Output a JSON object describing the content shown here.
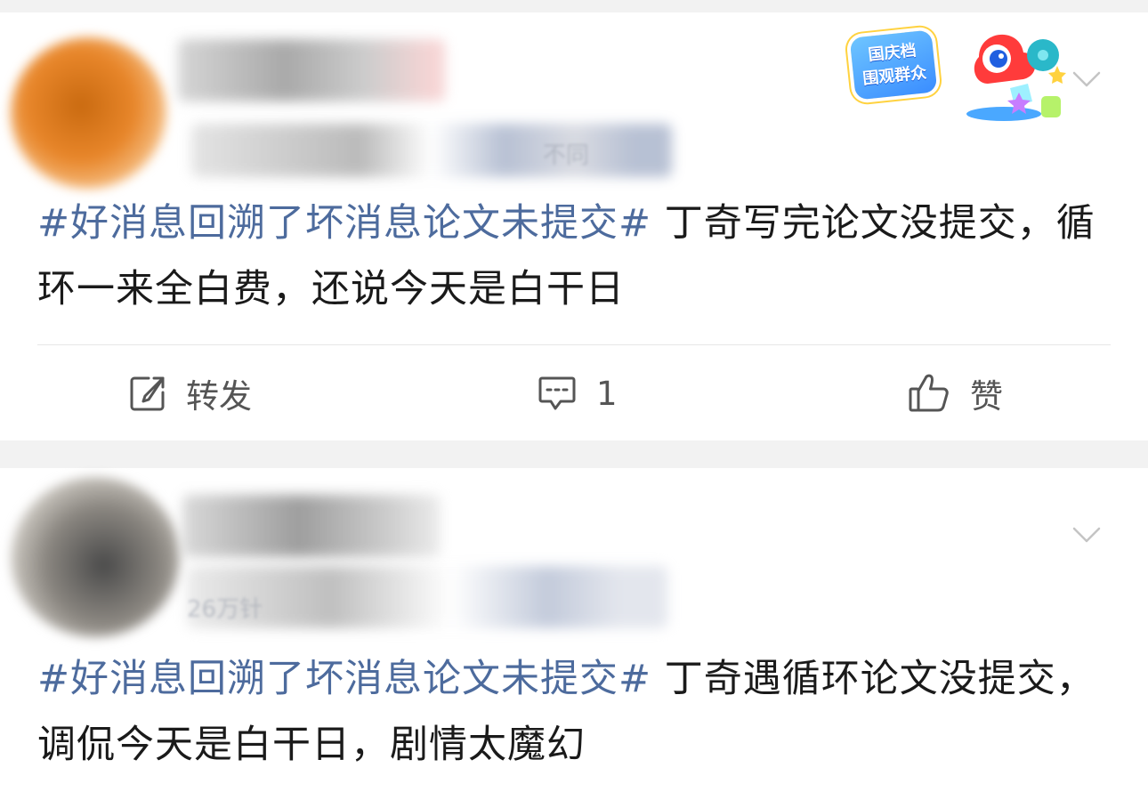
{
  "posts": [
    {
      "meta_text": "不同",
      "badge_text": [
        "国庆档",
        "围观群众"
      ],
      "hashtag": "#好消息回溯了坏消息论文未提交#",
      "body": " 丁奇写完论文没提交，循环一来全白费，还说今天是白干日",
      "actions": {
        "repost_label": "转发",
        "comment_count": "1",
        "like_label": "赞"
      }
    },
    {
      "meta_text": "26万针",
      "hashtag": "#好消息回溯了坏消息论文未提交#",
      "body": " 丁奇遇循环论文没提交，调侃今天是白干日，剧情太魔幻"
    }
  ],
  "colors": {
    "hashtag": "#4d6b9d",
    "text": "#1a1a1a",
    "action": "#555555",
    "page_bg": "#f2f2f2"
  },
  "icons": [
    "repost-icon",
    "comment-icon",
    "like-icon",
    "chevron-down-icon"
  ]
}
